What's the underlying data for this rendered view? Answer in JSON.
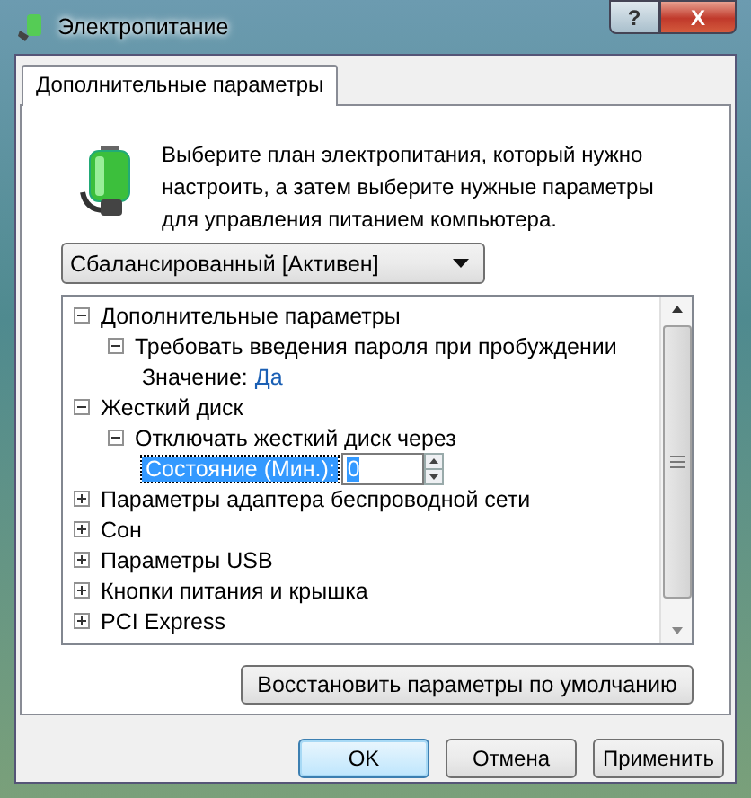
{
  "window": {
    "title": "Электропитание",
    "help_button": "?",
    "close_button": "X"
  },
  "tabs": [
    {
      "label": "Дополнительные параметры",
      "selected": true
    }
  ],
  "description": "Выберите план электропитания, который нужно настроить, а затем выберите нужные параметры для управления питанием компьютера.",
  "plan_dropdown": {
    "value": "Сбалансированный [Активен]"
  },
  "tree": [
    {
      "kind": "group",
      "label": "Дополнительные параметры",
      "expanded": true,
      "children": [
        {
          "kind": "group",
          "label": "Требовать введения пароля при пробуждении",
          "expanded": true,
          "children": [
            {
              "kind": "value",
              "label": "Значение:",
              "value": "Да"
            }
          ]
        }
      ]
    },
    {
      "kind": "group",
      "label": "Жесткий диск",
      "expanded": true,
      "children": [
        {
          "kind": "group",
          "label": "Отключать жесткий диск через",
          "expanded": true,
          "children": [
            {
              "kind": "spinner",
              "label": "Состояние (Мин.):",
              "value": "0",
              "selected": true
            }
          ]
        }
      ]
    },
    {
      "kind": "group",
      "label": "Параметры адаптера беспроводной сети",
      "expanded": false
    },
    {
      "kind": "group",
      "label": "Сон",
      "expanded": false
    },
    {
      "kind": "group",
      "label": "Параметры USB",
      "expanded": false
    },
    {
      "kind": "group",
      "label": "Кнопки питания и крышка",
      "expanded": false
    },
    {
      "kind": "group",
      "label": "PCI Express",
      "expanded": false
    }
  ],
  "restore_button": "Восстановить параметры по умолчанию",
  "buttons": [
    {
      "label": "OK",
      "default": true
    },
    {
      "label": "Отмена",
      "default": false
    },
    {
      "label": "Применить",
      "default": false
    }
  ]
}
